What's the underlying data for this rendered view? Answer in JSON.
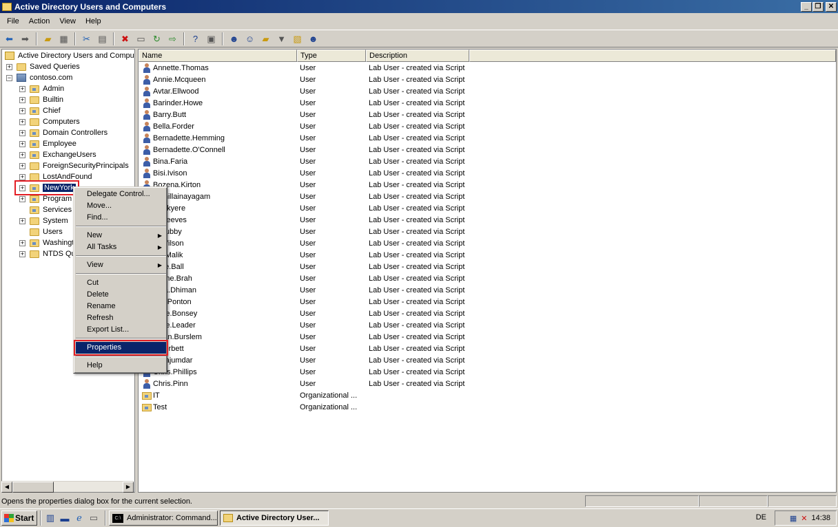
{
  "window": {
    "title": "Active Directory Users and Computers"
  },
  "menu": [
    "File",
    "Action",
    "View",
    "Help"
  ],
  "toolbar_icons": [
    "back-icon",
    "forward-icon",
    "up-folder-icon",
    "show-tree-icon",
    "cut-icon",
    "copy-icon",
    "delete-icon",
    "properties-sheet-icon",
    "refresh-icon",
    "export-icon",
    "help-icon",
    "console-icon",
    "new-user-icon",
    "new-group-icon",
    "new-ou-icon",
    "filter-icon",
    "find-icon",
    "add-to-group-icon"
  ],
  "tree": {
    "root": "Active Directory Users and Computers",
    "saved_queries": "Saved Queries",
    "domain": "contoso.com",
    "items": [
      "Admin",
      "Builtin",
      "Chief",
      "Computers",
      "Domain Controllers",
      "Employee",
      "ExchangeUsers",
      "ForeignSecurityPrincipals",
      "LostAndFound",
      "NewYork",
      "Program",
      "Services",
      "System",
      "Users",
      "Washingt",
      "NTDS Qu"
    ]
  },
  "list": {
    "columns": [
      "Name",
      "Type",
      "Description"
    ],
    "rows": [
      {
        "name": "Annette.Thomas",
        "type": "User",
        "desc": "Lab User - created via Script"
      },
      {
        "name": "Annie.Mcqueen",
        "type": "User",
        "desc": "Lab User - created via Script"
      },
      {
        "name": "Avtar.Ellwood",
        "type": "User",
        "desc": "Lab User - created via Script"
      },
      {
        "name": "Barinder.Howe",
        "type": "User",
        "desc": "Lab User - created via Script"
      },
      {
        "name": "Barry.Butt",
        "type": "User",
        "desc": "Lab User - created via Script"
      },
      {
        "name": "Bella.Forder",
        "type": "User",
        "desc": "Lab User - created via Script"
      },
      {
        "name": "Bernadette.Hemming",
        "type": "User",
        "desc": "Lab User - created via Script"
      },
      {
        "name": "Bernadette.O'Connell",
        "type": "User",
        "desc": "Lab User - created via Script"
      },
      {
        "name": "Bina.Faria",
        "type": "User",
        "desc": "Lab User - created via Script"
      },
      {
        "name": "Bisi.Ivison",
        "type": "User",
        "desc": "Lab User - created via Script"
      },
      {
        "name": "Bozena.Kirton",
        "type": "User",
        "desc": "Lab User - created via Script"
      },
      {
        "name": "e.Thillainayagam",
        "type": "User",
        "desc": "Lab User - created via Script"
      },
      {
        "name": "ol.Okyere",
        "type": "User",
        "desc": "Lab User - created via Script"
      },
      {
        "name": "ol.Reeves",
        "type": "User",
        "desc": "Lab User - created via Script"
      },
      {
        "name": "ol.Tubby",
        "type": "User",
        "desc": "Lab User - created via Script"
      },
      {
        "name": "ol.Wilson",
        "type": "User",
        "desc": "Lab User - created via Script"
      },
      {
        "name": "ole.Malik",
        "type": "User",
        "desc": "Lab User - created via Script"
      },
      {
        "name": "oline.Ball",
        "type": "User",
        "desc": "Lab User - created via Script"
      },
      {
        "name": "herine.Brah",
        "type": "User",
        "desc": "Lab User - created via Script"
      },
      {
        "name": "ndra.Dhiman",
        "type": "User",
        "desc": "Lab User - created via Script"
      },
      {
        "name": "rles.Ponton",
        "type": "User",
        "desc": "Lab User - created via Script"
      },
      {
        "name": "rlotte.Bonsey",
        "type": "User",
        "desc": "Lab User - created via Script"
      },
      {
        "name": "rlotte.Leader",
        "type": "User",
        "desc": "Lab User - created via Script"
      },
      {
        "name": "rmian.Burslem",
        "type": "User",
        "desc": "Lab User - created via Script"
      },
      {
        "name": "s.Corbett",
        "type": "User",
        "desc": "Lab User - created via Script"
      },
      {
        "name": "s.Majumdar",
        "type": "User",
        "desc": "Lab User - created via Script"
      },
      {
        "name": "Chris.Phillips",
        "type": "User",
        "desc": "Lab User - created via Script"
      },
      {
        "name": "Chris.Pinn",
        "type": "User",
        "desc": "Lab User - created via Script"
      },
      {
        "name": "IT",
        "type": "Organizational ...",
        "desc": "",
        "ou": true
      },
      {
        "name": "Test",
        "type": "Organizational ...",
        "desc": "",
        "ou": true
      }
    ]
  },
  "context_menu": {
    "delegate": "Delegate Control...",
    "move": "Move...",
    "find": "Find...",
    "new": "New",
    "all_tasks": "All Tasks",
    "view": "View",
    "cut": "Cut",
    "delete": "Delete",
    "rename": "Rename",
    "refresh": "Refresh",
    "export": "Export List...",
    "properties": "Properties",
    "help": "Help"
  },
  "status": {
    "message": "Opens the properties dialog box for the current selection."
  },
  "taskbar": {
    "start": "Start",
    "tasks": [
      "Administrator: Command...",
      "Active Directory User..."
    ],
    "language": "DE",
    "clock": "14:38"
  }
}
